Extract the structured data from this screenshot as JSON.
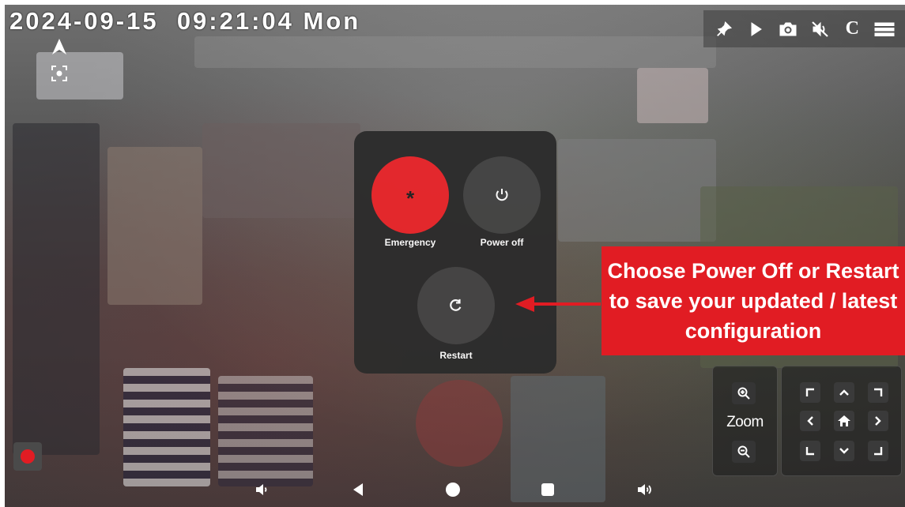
{
  "overlay": {
    "date": "2024-09-15",
    "time": "09:21:04",
    "weekday": "Mon"
  },
  "topbar": {
    "icons": [
      "pin-icon",
      "play-icon",
      "camera-icon",
      "mute-icon",
      "c-icon",
      "menu-icon"
    ],
    "c_label": "C"
  },
  "left_tools": [
    "navigation-arrow-icon",
    "focus-frame-icon"
  ],
  "power_menu": {
    "emergency_label": "Emergency",
    "emergency_symbol": "*",
    "power_off_label": "Power off",
    "restart_label": "Restart",
    "emergency_color": "#e8262b"
  },
  "callout": {
    "line1": "Choose Power Off or Restart",
    "line2": "to save your updated / latest",
    "line3": "configuration",
    "color": "#e11c23"
  },
  "zoom": {
    "label": "Zoom",
    "icons": [
      "zoom-in-icon",
      "zoom-out-icon"
    ]
  },
  "ptz": {
    "icons": [
      "up-left-icon",
      "up-icon",
      "up-right-icon",
      "left-icon",
      "home-icon",
      "right-icon",
      "down-left-icon",
      "down-icon",
      "down-right-icon"
    ]
  },
  "record": {
    "color": "#e11c23"
  },
  "navbar": {
    "icons": [
      "volume-down-icon",
      "back-icon",
      "home-circle-icon",
      "recents-icon",
      "volume-up-icon"
    ]
  }
}
